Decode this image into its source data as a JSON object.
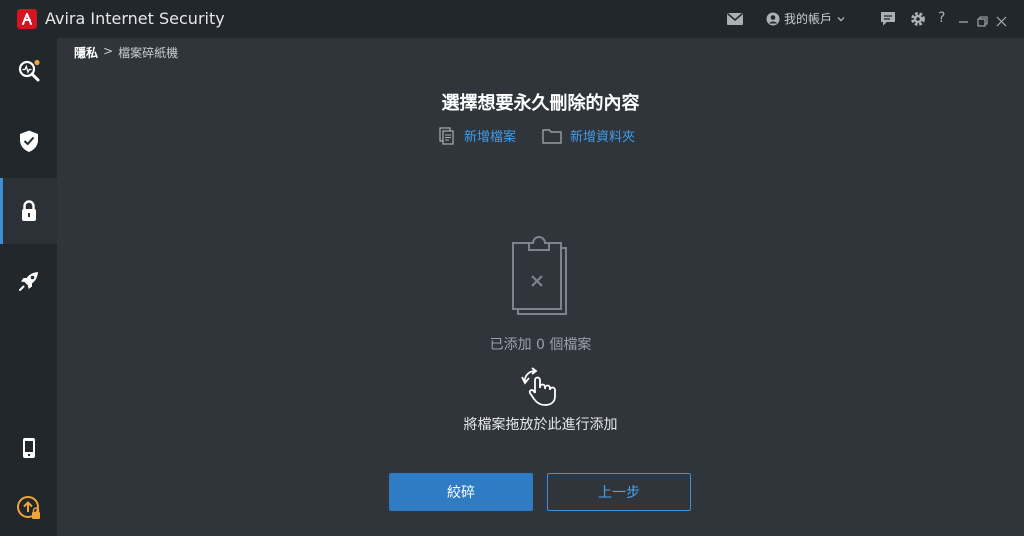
{
  "app": {
    "title": "Avira Internet Security"
  },
  "titlebar": {
    "account_label": "我的帳戶",
    "help_label": "?"
  },
  "breadcrumb": {
    "parent": "隱私",
    "separator": ">",
    "current": "檔案碎紙機"
  },
  "main": {
    "title": "選擇想要永久刪除的內容",
    "add_file_label": "新增檔案",
    "add_folder_label": "新增資料夾",
    "files_added": "已添加 0 個檔案",
    "drop_hint": "將檔案拖放於此進行添加"
  },
  "buttons": {
    "shred_label": "絞碎",
    "back_label": "上一步"
  },
  "colors": {
    "accent": "#3f8fd8",
    "brand": "#d4141f",
    "notification": "#f0a33a",
    "background": "#2f353b",
    "sidebar": "#22272c"
  },
  "sidebar": {
    "items": [
      {
        "icon": "scan-search-icon",
        "has_notification": true
      },
      {
        "icon": "shield-check-icon"
      },
      {
        "icon": "lock-icon",
        "active": true
      },
      {
        "icon": "rocket-icon"
      },
      {
        "icon": "mobile-phone-icon"
      },
      {
        "icon": "upgrade-icon"
      }
    ]
  }
}
